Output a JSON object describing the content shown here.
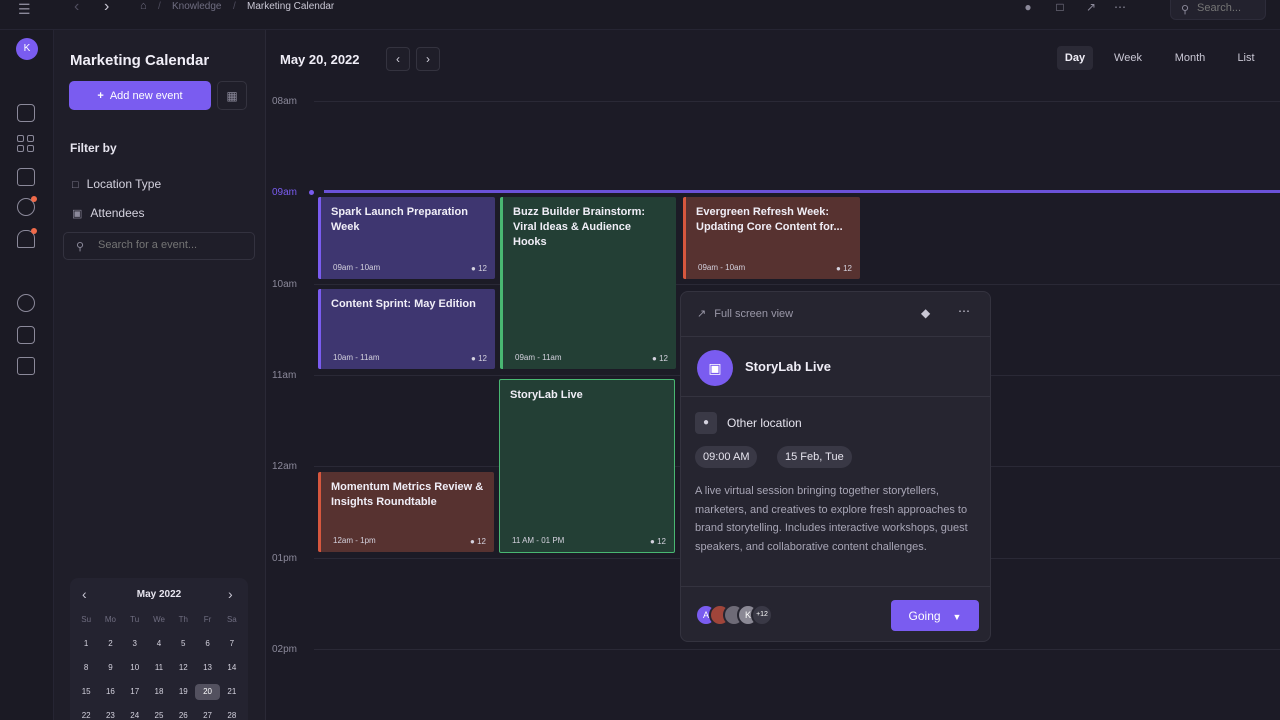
{
  "breadcrumb": {
    "home_icon": "home-icon",
    "items": [
      "Knowledge",
      "Marketing Calendar"
    ]
  },
  "topbar": {
    "search_placeholder": "Search..."
  },
  "rail": {
    "avatar": "K"
  },
  "sidebar": {
    "title": "Marketing Calendar",
    "add_label": "Add new event",
    "filter_label": "Filter by",
    "filters": [
      "Location Type",
      "Attendees"
    ],
    "search_placeholder": "Search for a event..."
  },
  "mini_calendar": {
    "title": "May 2022",
    "weekdays": [
      "Su",
      "Mo",
      "Tu",
      "We",
      "Th",
      "Fr",
      "Sa"
    ],
    "days": [
      "1",
      "2",
      "3",
      "4",
      "5",
      "6",
      "7",
      "8",
      "9",
      "10",
      "11",
      "12",
      "13",
      "14",
      "15",
      "16",
      "17",
      "18",
      "19",
      "20",
      "21",
      "22",
      "23",
      "24",
      "25",
      "26",
      "27",
      "28"
    ],
    "selected": "20"
  },
  "main": {
    "date": "May 20, 2022",
    "views": [
      "Day",
      "Week",
      "Month",
      "List"
    ],
    "active_view": "Day",
    "hours": [
      "08am",
      "10am",
      "11am",
      "12am",
      "01pm",
      "02pm"
    ],
    "now_label": "09am"
  },
  "events": [
    {
      "title": "Spark Launch Preparation Week",
      "time": "09am - 10am",
      "attendees": "12"
    },
    {
      "title": "Content Sprint: May Edition",
      "time": "10am - 11am",
      "attendees": "12"
    },
    {
      "title": "Momentum Metrics Review & Insights Roundtable",
      "time": "12am - 1pm",
      "attendees": "12"
    },
    {
      "title": "Buzz Builder Brainstorm: Viral Ideas & Audience Hooks",
      "time": "09am - 11am",
      "attendees": "12"
    },
    {
      "title": "StoryLab Live",
      "time": "11 AM - 01 PM",
      "attendees": "12"
    },
    {
      "title": "Evergreen Refresh Week: Updating Core Content for...",
      "time": "09am - 10am",
      "attendees": "12"
    }
  ],
  "popover": {
    "fullscreen_label": "Full screen view",
    "title": "StoryLab Live",
    "location": "Other location",
    "time_chip": "09:00 AM",
    "date_chip": "15 Feb, Tue",
    "description": "A live virtual session bringing together storytellers, marketers, and creatives to explore fresh approaches to brand storytelling. Includes interactive workshops, guest speakers, and collaborative content challenges.",
    "avatars": [
      "A",
      "",
      "",
      "K"
    ],
    "more_count": "+12",
    "going_label": "Going"
  },
  "colors": {
    "accent": "#7a5cf0",
    "green": "#49b772",
    "red": "#d6573e"
  }
}
